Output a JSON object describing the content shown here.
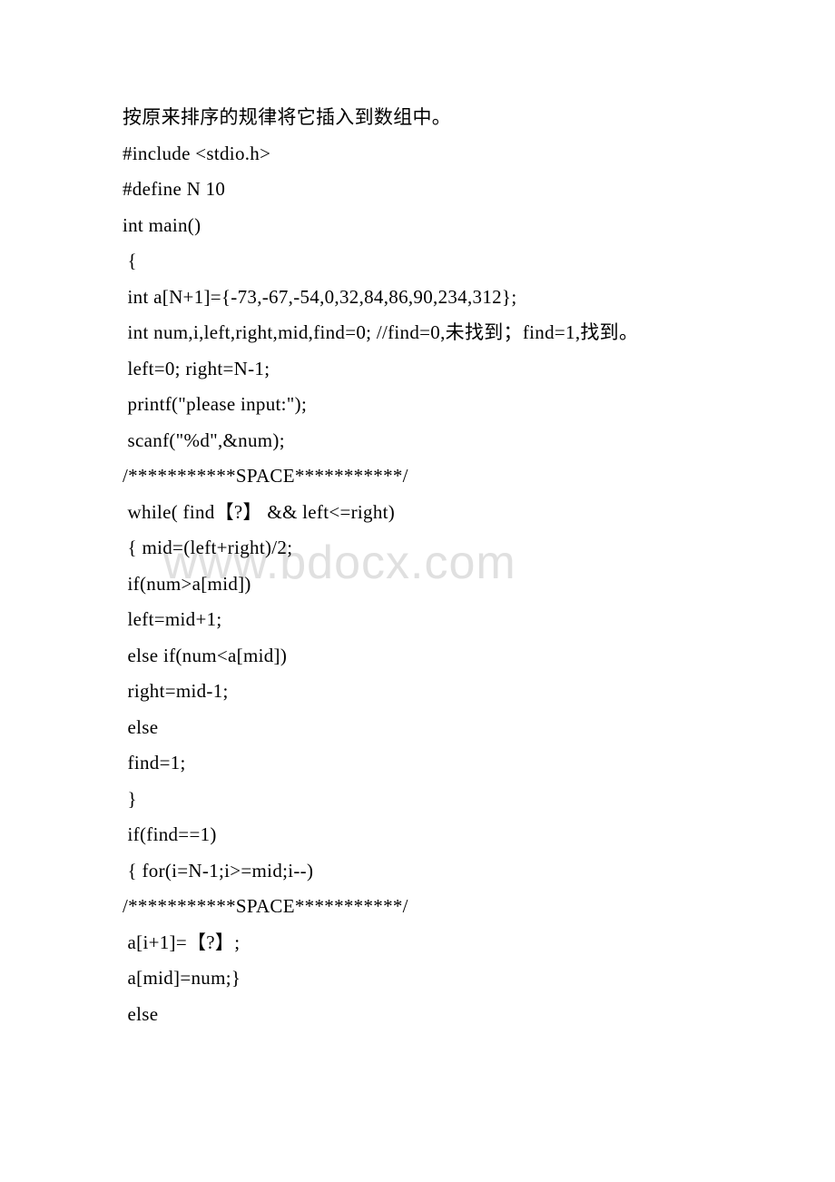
{
  "watermark": "www.bdocx.com",
  "lines": [
    "按原来排序的规律将它插入到数组中。",
    "#include <stdio.h>",
    "#define N 10",
    "int main()",
    " {",
    " int a[N+1]={-73,-67,-54,0,32,84,86,90,234,312};",
    " int num,i,left,right,mid,find=0; //find=0,未找到；find=1,找到。",
    " left=0; right=N-1;",
    " printf(\"please input:\");",
    " scanf(\"%d\",&num);",
    "/***********SPACE***********/",
    " while( find【?】 && left<=right)",
    " { mid=(left+right)/2;",
    " if(num>a[mid])",
    " left=mid+1;",
    " else if(num<a[mid])",
    " right=mid-1;",
    " else",
    " find=1;",
    " }",
    " if(find==1)",
    " { for(i=N-1;i>=mid;i--)",
    "/***********SPACE***********/",
    " a[i+1]=【?】;",
    " a[mid]=num;}",
    " else"
  ]
}
